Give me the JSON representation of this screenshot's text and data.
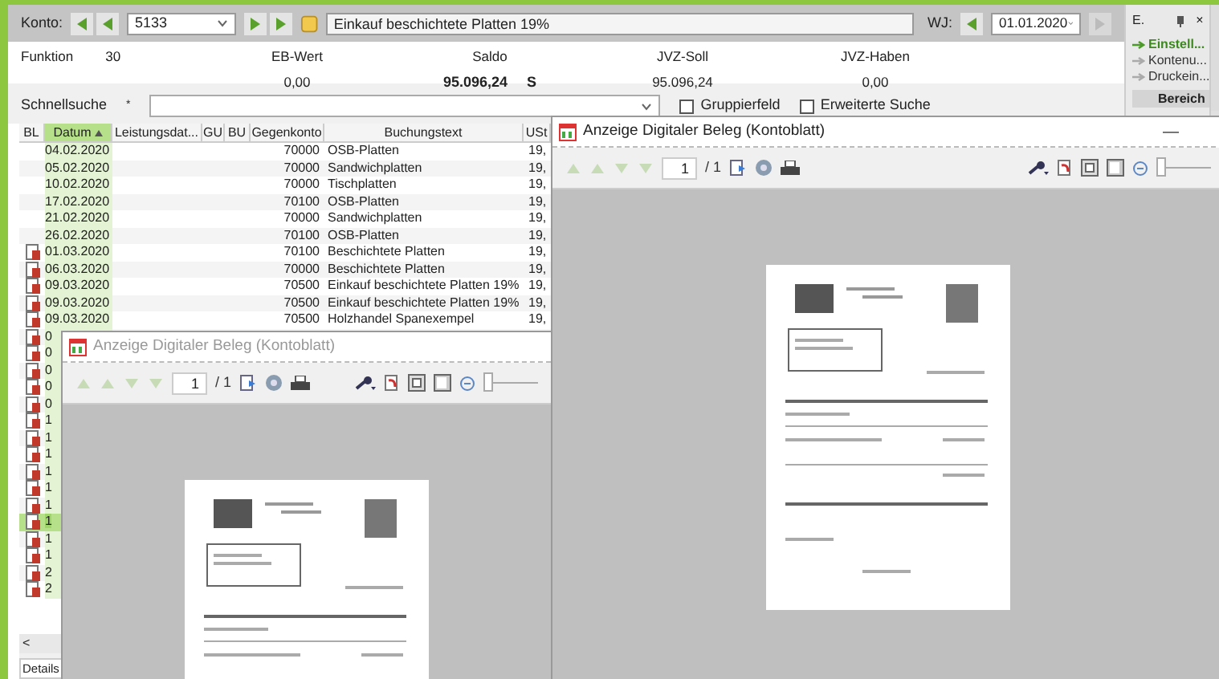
{
  "toolbar": {
    "konto_label": "Konto:",
    "konto_number": "5133",
    "account_name": "Einkauf beschichtete Platten 19%",
    "wj_label": "WJ:",
    "wj_date": "01.01.2020"
  },
  "function": {
    "label": "Funktion",
    "value": "30"
  },
  "summary": [
    {
      "label": "EB-Wert",
      "value": "0,00",
      "bold": false
    },
    {
      "label": "Saldo",
      "value": "95.096,24",
      "suffix": "S",
      "bold": true
    },
    {
      "label": "JVZ-Soll",
      "value": "95.096,24",
      "bold": false
    },
    {
      "label": "JVZ-Haben",
      "value": "0,00",
      "bold": false
    }
  ],
  "quick_search": {
    "label": "Schnellsuche",
    "marker": "*"
  },
  "options": [
    {
      "label": "Gruppierfeld",
      "checked": false
    },
    {
      "label": "Erweiterte Suche",
      "checked": false
    }
  ],
  "table": {
    "columns": [
      {
        "label": "BL",
        "sorted": false
      },
      {
        "label": "Datum",
        "sorted": true
      },
      {
        "label": "Leistungsdat...",
        "sorted": false
      },
      {
        "label": "GU",
        "sorted": false
      },
      {
        "label": "BU",
        "sorted": false
      },
      {
        "label": "Gegenkonto",
        "sorted": false
      },
      {
        "label": "Buchungstext",
        "sorted": false
      },
      {
        "label": "USt",
        "sorted": false
      }
    ],
    "rows": [
      {
        "document": false,
        "datum": "04.02.2020",
        "gegenkonto": "70000",
        "text": "OSB-Platten",
        "ust": "19,",
        "selected": false
      },
      {
        "document": false,
        "datum": "05.02.2020",
        "gegenkonto": "70000",
        "text": "Sandwichplatten",
        "ust": "19,",
        "selected": false
      },
      {
        "document": false,
        "datum": "10.02.2020",
        "gegenkonto": "70000",
        "text": "Tischplatten",
        "ust": "19,",
        "selected": false
      },
      {
        "document": false,
        "datum": "17.02.2020",
        "gegenkonto": "70100",
        "text": "OSB-Platten",
        "ust": "19,",
        "selected": false
      },
      {
        "document": false,
        "datum": "21.02.2020",
        "gegenkonto": "70000",
        "text": "Sandwichplatten",
        "ust": "19,",
        "selected": false
      },
      {
        "document": false,
        "datum": "26.02.2020",
        "gegenkonto": "70100",
        "text": "OSB-Platten",
        "ust": "19,",
        "selected": false
      },
      {
        "document": true,
        "datum": "01.03.2020",
        "gegenkonto": "70100",
        "text": "Beschichtete Platten",
        "ust": "19,",
        "selected": false
      },
      {
        "document": true,
        "datum": "06.03.2020",
        "gegenkonto": "70000",
        "text": "Beschichtete Platten",
        "ust": "19,",
        "selected": false
      },
      {
        "document": true,
        "datum": "09.03.2020",
        "gegenkonto": "70500",
        "text": "Einkauf beschichtete Platten 19%",
        "ust": "19,",
        "selected": false
      },
      {
        "document": true,
        "datum": "09.03.2020",
        "gegenkonto": "70500",
        "text": "Einkauf beschichtete Platten 19%",
        "ust": "19,",
        "selected": false
      },
      {
        "document": true,
        "datum": "09.03.2020",
        "gegenkonto": "70500",
        "text": "Holzhandel Spanexempel",
        "ust": "19,",
        "selected": false
      },
      {
        "document": true,
        "datum": "0",
        "selected": false
      },
      {
        "document": true,
        "datum": "0",
        "selected": false
      },
      {
        "document": true,
        "datum": "0",
        "selected": false
      },
      {
        "document": true,
        "datum": "0",
        "selected": false
      },
      {
        "document": true,
        "datum": "0",
        "selected": false
      },
      {
        "document": true,
        "datum": "1",
        "selected": false
      },
      {
        "document": true,
        "datum": "1",
        "selected": false
      },
      {
        "document": true,
        "datum": "1",
        "selected": false
      },
      {
        "document": true,
        "datum": "1",
        "selected": false
      },
      {
        "document": true,
        "datum": "1",
        "selected": false
      },
      {
        "document": true,
        "datum": "1",
        "selected": false
      },
      {
        "document": true,
        "datum": "1",
        "selected": true
      },
      {
        "document": true,
        "datum": "1",
        "selected": false
      },
      {
        "document": true,
        "datum": "1",
        "selected": false
      },
      {
        "document": true,
        "datum": "2",
        "selected": false
      },
      {
        "document": true,
        "datum": "2",
        "selected": false
      }
    ]
  },
  "scroll_left": "<",
  "details_tab": "Details",
  "side_panel": {
    "title": "E.",
    "close": "×",
    "links": [
      {
        "label": "Einstell...",
        "active": true
      },
      {
        "label": "Kontenu...",
        "active": false
      },
      {
        "label": "Druckein...",
        "active": false
      }
    ],
    "section": "Bereich"
  },
  "viewers": [
    {
      "title": "Anzeige Digitaler Beleg (Kontoblatt)",
      "active": false,
      "page": "1",
      "pages": "/ 1",
      "zoom": {
        "level": 0
      }
    },
    {
      "title": "Anzeige Digitaler Beleg (Kontoblatt)",
      "active": true,
      "page": "1",
      "pages": "/ 1",
      "minimize": "—",
      "zoom": {
        "level": 0
      }
    }
  ]
}
